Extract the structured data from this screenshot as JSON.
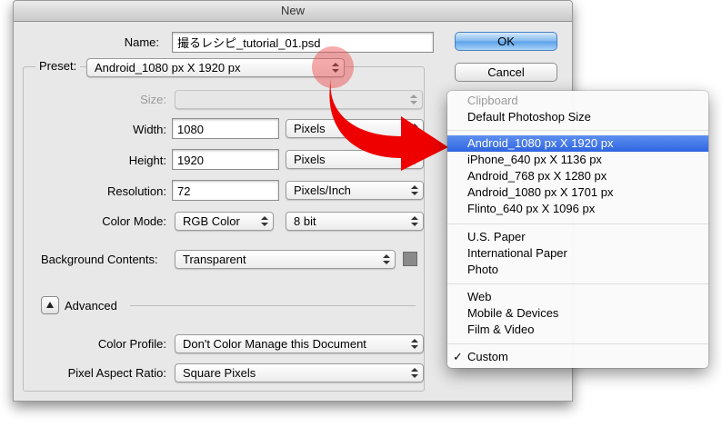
{
  "window": {
    "title": "New"
  },
  "name": {
    "label": "Name:",
    "value": "撮るレシピ_tutorial_01.psd"
  },
  "preset": {
    "label": "Preset:",
    "value": "Android_1080 px X 1920 px"
  },
  "size": {
    "label": "Size:",
    "value": ""
  },
  "width": {
    "label": "Width:",
    "value": "1080",
    "unit": "Pixels"
  },
  "height": {
    "label": "Height:",
    "value": "1920",
    "unit": "Pixels"
  },
  "resolution": {
    "label": "Resolution:",
    "value": "72",
    "unit": "Pixels/Inch"
  },
  "color_mode": {
    "label": "Color Mode:",
    "value": "RGB Color",
    "depth": "8 bit"
  },
  "background": {
    "label": "Background Contents:",
    "value": "Transparent"
  },
  "advanced": {
    "label": "Advanced"
  },
  "color_profile": {
    "label": "Color Profile:",
    "value": "Don't Color Manage this Document"
  },
  "pixel_aspect": {
    "label": "Pixel Aspect Ratio:",
    "value": "Square Pixels"
  },
  "buttons": {
    "ok": "OK",
    "cancel": "Cancel"
  },
  "menu": {
    "items": [
      {
        "label": "Clipboard",
        "state": "disabled"
      },
      {
        "label": "Default Photoshop Size"
      },
      {
        "label": "Android_1080 px X 1920 px",
        "state": "selected"
      },
      {
        "label": "iPhone_640 px X 1136 px"
      },
      {
        "label": "Android_768 px X 1280 px"
      },
      {
        "label": "Android_1080 px X 1701 px"
      },
      {
        "label": "Flinto_640 px X 1096 px"
      },
      {
        "label": "U.S. Paper"
      },
      {
        "label": "International Paper"
      },
      {
        "label": "Photo"
      },
      {
        "label": "Web"
      },
      {
        "label": "Mobile & Devices"
      },
      {
        "label": "Film & Video"
      },
      {
        "label": "Custom",
        "check": "✓"
      }
    ]
  },
  "colors": {
    "highlight": "#3a6fe3",
    "arrow": "#ee0000"
  }
}
